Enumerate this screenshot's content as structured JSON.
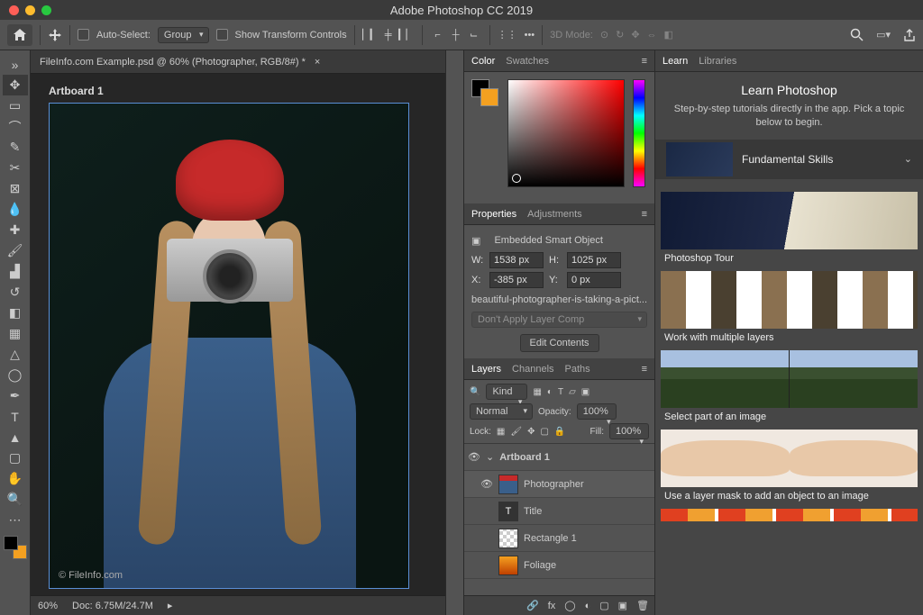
{
  "titlebar": {
    "title": "Adobe Photoshop CC 2019"
  },
  "optbar": {
    "autoSelectLabel": "Auto-Select:",
    "autoSelectMode": "Group",
    "showTransformLabel": "Show Transform Controls",
    "modeLabel": "3D Mode:"
  },
  "document": {
    "tabTitle": "FileInfo.com Example.psd @ 60% (Photographer, RGB/8#) *",
    "artboardLabel": "Artboard 1",
    "watermark": "© FileInfo.com"
  },
  "statusbar": {
    "zoom": "60%",
    "docSize": "Doc: 6.75M/24.7M"
  },
  "colorPanel": {
    "tab1": "Color",
    "tab2": "Swatches"
  },
  "properties": {
    "tab1": "Properties",
    "tab2": "Adjustments",
    "typeLabel": "Embedded Smart Object",
    "wLabel": "W:",
    "w": "1538 px",
    "hLabel": "H:",
    "h": "1025 px",
    "xLabel": "X:",
    "x": "-385 px",
    "yLabel": "Y:",
    "y": "0 px",
    "filename": "beautiful-photographer-is-taking-a-pict...",
    "layerComp": "Don't Apply Layer Comp",
    "editBtn": "Edit Contents"
  },
  "layers": {
    "tab1": "Layers",
    "tab2": "Channels",
    "tab3": "Paths",
    "kindLabel": "Kind",
    "blendMode": "Normal",
    "opacityLabel": "Opacity:",
    "opacity": "100%",
    "lockLabel": "Lock:",
    "fillLabel": "Fill:",
    "fill": "100%",
    "items": [
      {
        "name": "Artboard 1",
        "artboard": true
      },
      {
        "name": "Photographer",
        "selected": true
      },
      {
        "name": "Title"
      },
      {
        "name": "Rectangle 1"
      },
      {
        "name": "Foliage"
      }
    ]
  },
  "learn": {
    "tab1": "Learn",
    "tab2": "Libraries",
    "heading": "Learn Photoshop",
    "sub": "Step-by-step tutorials directly in the app. Pick a topic below to begin.",
    "section": "Fundamental Skills",
    "tutorials": [
      "Photoshop Tour",
      "Work with multiple layers",
      "Select part of an image",
      "Use a layer mask to add an object to an image"
    ]
  },
  "swatches": {
    "fg": "#000000",
    "bg": "#f4a020"
  }
}
